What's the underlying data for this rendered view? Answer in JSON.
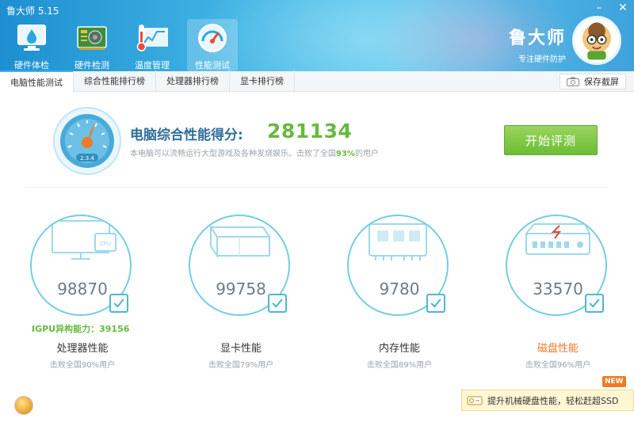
{
  "window": {
    "title": "鲁大师 5.15",
    "minimize_icon": "minimize-icon",
    "close_icon": "close-icon"
  },
  "nav": {
    "items": [
      {
        "label": "硬件体检",
        "icon": "health-check-icon"
      },
      {
        "label": "硬件检测",
        "icon": "hardware-board-icon"
      },
      {
        "label": "温度管理",
        "icon": "thermometer-icon"
      },
      {
        "label": "性能测试",
        "icon": "speedometer-icon",
        "active": true
      }
    ]
  },
  "brand": {
    "name": "鲁大师",
    "slogan": "专注硬件防护",
    "avatar_icon": "mascot-avatar-icon"
  },
  "tabs": [
    {
      "label": "电脑性能测试",
      "active": true
    },
    {
      "label": "综合性能排行榜"
    },
    {
      "label": "处理器排行榜"
    },
    {
      "label": "显卡排行榜"
    }
  ],
  "save_screenshot": {
    "label": "保存截屏",
    "icon": "camera-icon"
  },
  "summary": {
    "gauge_icon": "speedometer-gauge-icon",
    "gauge_text": "2.3.4",
    "label": "电脑综合性能得分:",
    "score": "281134",
    "desc_before": "本电脑可以流畅运行大型游戏及各种发烧娱乐。击败了全国",
    "desc_pct": "93%",
    "desc_after": "的用户",
    "start_button": "开始评测"
  },
  "components": [
    {
      "name": "处理器性能",
      "score": "98870",
      "beat": "击败全国90%用户",
      "icon": "cpu-monitor-icon",
      "extra": "IGPU异构能力：39156"
    },
    {
      "name": "显卡性能",
      "score": "99758",
      "beat": "击败全国79%用户",
      "icon": "gpu-cube-icon"
    },
    {
      "name": "内存性能",
      "score": "9780",
      "beat": "击败全国89%用户",
      "icon": "memory-module-icon"
    },
    {
      "name": "磁盘性能",
      "score": "33570",
      "beat": "击败全国96%用户",
      "icon": "hard-disk-icon",
      "warn": true
    }
  ],
  "promo": {
    "text": "提升机械硬盘性能，轻松赶超SSD",
    "badge": "NEW",
    "icon": "ssd-icon"
  },
  "colors": {
    "header_blue": "#3fb2e4",
    "score_green": "#67b93f",
    "ring_blue": "#72cde6",
    "warn_orange": "#e8792a"
  }
}
